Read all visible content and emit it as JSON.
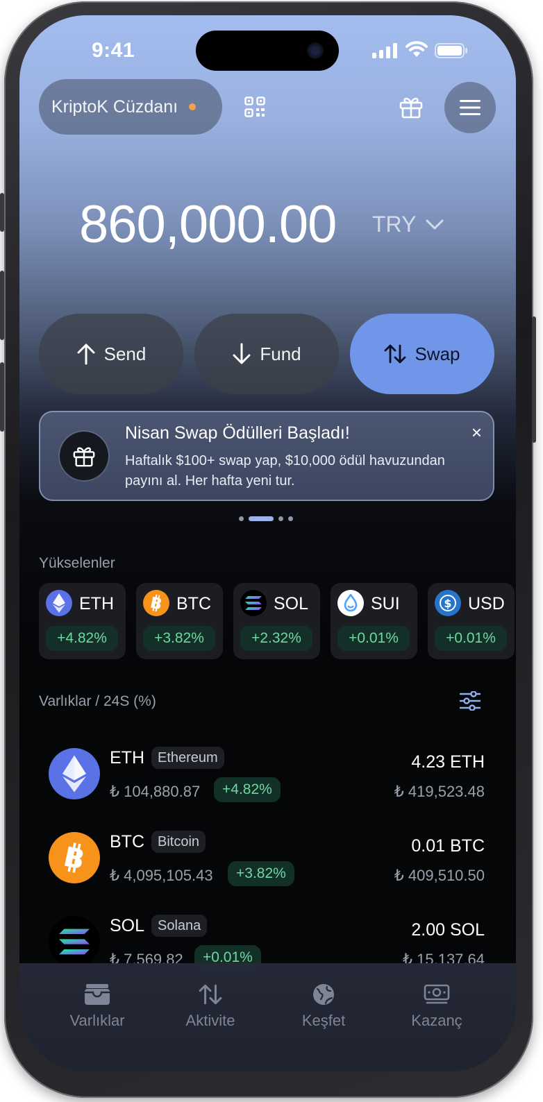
{
  "status_bar": {
    "time": "9:41"
  },
  "header": {
    "wallet_name": "KriptoK Cüzdanı",
    "icons": [
      "qr-code-icon",
      "gift-icon",
      "menu-icon"
    ]
  },
  "balance": {
    "amount": "860,000.00",
    "currency": "TRY"
  },
  "actions": [
    {
      "label": "Send",
      "icon": "arrow-up-icon"
    },
    {
      "label": "Fund",
      "icon": "arrow-down-icon"
    },
    {
      "label": "Swap",
      "icon": "swap-arrows-icon"
    }
  ],
  "banner": {
    "title": "Nisan Swap Ödülleri Başladı!",
    "body": "Haftalık $100+ swap yap, $10,000 ödül havuzundan payını al. Her hafta yeni tur.",
    "close": "×"
  },
  "carousel": {
    "count": 4,
    "active_index": 1
  },
  "movers": {
    "title": "Yükselenler",
    "items": [
      {
        "symbol": "ETH",
        "change": "+4.82%",
        "icon": "ethereum-icon"
      },
      {
        "symbol": "BTC",
        "change": "+3.82%",
        "icon": "bitcoin-icon"
      },
      {
        "symbol": "SOL",
        "change": "+2.32%",
        "icon": "solana-icon"
      },
      {
        "symbol": "SUI",
        "change": "+0.01%",
        "icon": "sui-icon"
      },
      {
        "symbol": "USD",
        "change": "+0.01%",
        "icon": "usdc-icon"
      }
    ]
  },
  "assets": {
    "title": "Varlıklar / 24S (%)",
    "items": [
      {
        "symbol": "ETH",
        "name": "Ethereum",
        "price": "₺ 104,880.87",
        "change": "+4.82%",
        "qty": "4.23 ETH",
        "value": "₺ 419,523.48",
        "icon": "ethereum-icon"
      },
      {
        "symbol": "BTC",
        "name": "Bitcoin",
        "price": "₺ 4,095,105.43",
        "change": "+3.82%",
        "qty": "0.01 BTC",
        "value": "₺ 409,510.50",
        "icon": "bitcoin-icon"
      },
      {
        "symbol": "SOL",
        "name": "Solana",
        "price": "₺ 7,569.82",
        "change": "+0.01%",
        "qty": "2.00 SOL",
        "value": "₺ 15,137.64",
        "icon": "solana-icon"
      }
    ]
  },
  "tabs": [
    {
      "label": "Varlıklar",
      "icon": "wallet-icon"
    },
    {
      "label": "Aktivite",
      "icon": "swap-arrows-icon"
    },
    {
      "label": "Keşfet",
      "icon": "globe-icon"
    },
    {
      "label": "Kazanç",
      "icon": "money-icon"
    }
  ],
  "colors": {
    "accent": "#6f96e8",
    "positive": "#6fd8a2",
    "positive_bg": "#123027",
    "eth": "#5a72e6",
    "btc": "#f7931a"
  }
}
